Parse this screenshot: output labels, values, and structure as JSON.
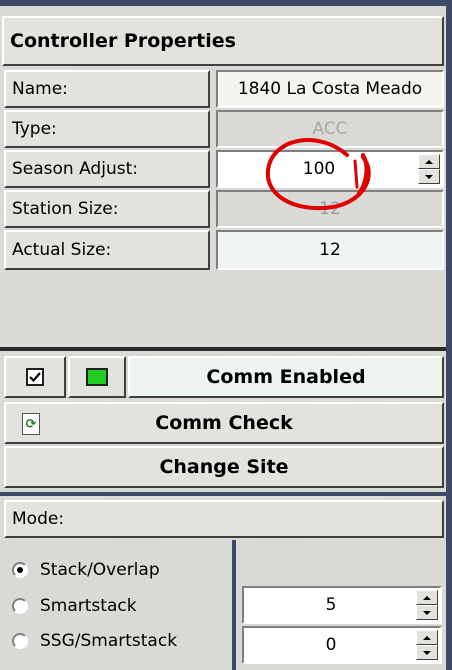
{
  "panel": {
    "title": "Controller Properties"
  },
  "properties": [
    {
      "label": "Name:",
      "value": "1840 La Costa Meado",
      "state": "normal"
    },
    {
      "label": "Type:",
      "value": "ACC",
      "state": "disabled"
    },
    {
      "label": "Season Adjust:",
      "value": "100",
      "state": "spinner"
    },
    {
      "label": "Station Size:",
      "value": "12",
      "state": "disabled"
    },
    {
      "label": "Actual Size:",
      "value": "12",
      "state": "readonly"
    }
  ],
  "comm": {
    "enabled_checked": true,
    "status_color": "#22cc22",
    "enabled_label": "Comm Enabled",
    "check_label": "Comm Check",
    "check_icon": "refresh-icon",
    "change_site_label": "Change Site"
  },
  "mode": {
    "label": "Mode:",
    "options": [
      {
        "label": "Stack/Overlap",
        "selected": true
      },
      {
        "label": "Smartstack",
        "selected": false
      },
      {
        "label": "SSG/Smartstack",
        "selected": false
      }
    ],
    "smartstack_value": "5",
    "ssg_value": "0"
  },
  "annotation_color": "#e00000"
}
